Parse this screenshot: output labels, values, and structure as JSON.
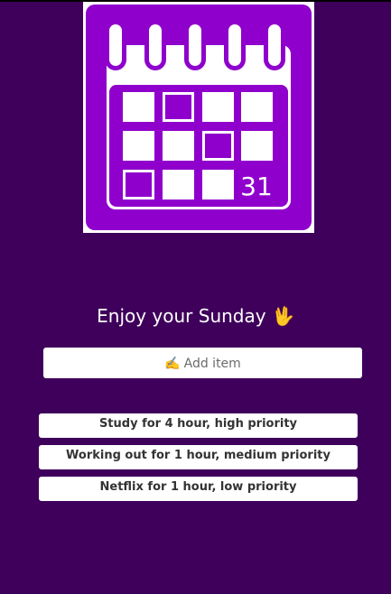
{
  "header": {
    "logo_icon": "calendar-icon",
    "logo_day_number": "31",
    "colors": {
      "background": "#3f005b",
      "accent": "#8f00cc"
    }
  },
  "greeting": {
    "text": "Enjoy your Sunday",
    "emoji": "🖖"
  },
  "add_item": {
    "icon": "✍️",
    "label": "Add item"
  },
  "tasks": [
    {
      "label": "Study for 4 hour, high priority"
    },
    {
      "label": "Working out for 1 hour, medium priority"
    },
    {
      "label": "Netflix for 1 hour, low priority"
    }
  ]
}
